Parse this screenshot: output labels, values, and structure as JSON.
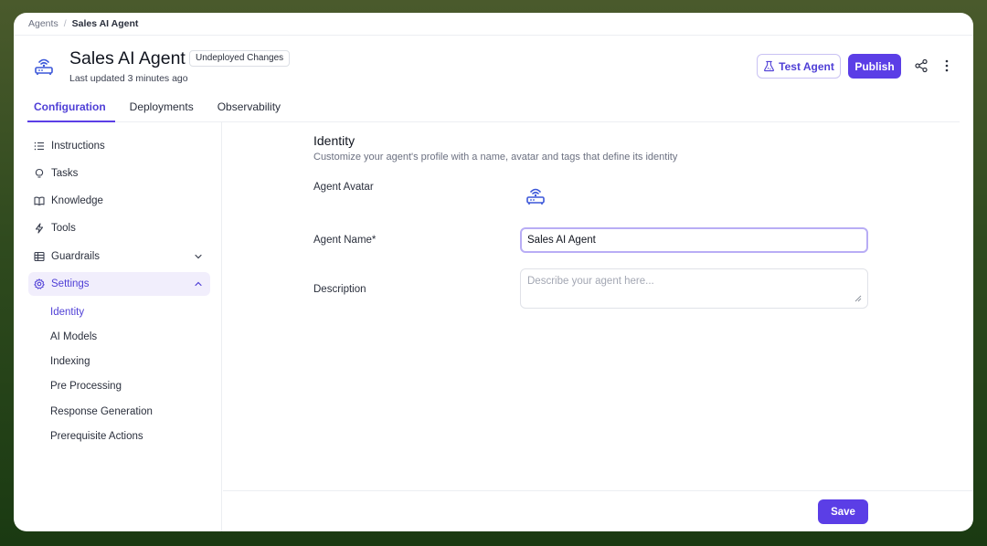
{
  "breadcrumb": {
    "parent": "Agents",
    "separator": "/",
    "current": "Sales AI Agent"
  },
  "header": {
    "title": "Sales AI Agent",
    "badge": "Undeployed Changes",
    "subtitle": "Last updated 3 minutes ago",
    "test_label": "Test Agent",
    "publish_label": "Publish",
    "icons": [
      "router-icon",
      "flask-icon",
      "share-icon",
      "more-vertical-icon"
    ]
  },
  "tabs": [
    {
      "label": "Configuration",
      "active": true
    },
    {
      "label": "Deployments",
      "active": false
    },
    {
      "label": "Observability",
      "active": false
    }
  ],
  "sidebar": {
    "items": [
      {
        "label": "Instructions",
        "icon": "list-icon"
      },
      {
        "label": "Tasks",
        "icon": "lightbulb-icon"
      },
      {
        "label": "Knowledge",
        "icon": "book-icon"
      },
      {
        "label": "Tools",
        "icon": "bolt-icon"
      },
      {
        "label": "Guardrails",
        "icon": "table-icon"
      },
      {
        "label": "Settings",
        "icon": "gear-icon"
      }
    ],
    "sub_items": [
      "Identity",
      "AI Models",
      "Indexing",
      "Pre Processing",
      "Response Generation",
      "Prerequisite Actions"
    ]
  },
  "identity": {
    "title": "Identity",
    "description": "Customize your agent's profile with a name, avatar and tags that define its identity",
    "avatar_label": "Agent Avatar",
    "name_label": "Agent Name*",
    "name_value": "Sales AI Agent",
    "description_label": "Description",
    "description_placeholder": "Describe your agent here..."
  },
  "footer": {
    "save_label": "Save"
  },
  "colors": {
    "accent": "#5b3ee6",
    "accent_light": "#f1eefc",
    "text": "#2a2f3c",
    "muted": "#6b7080"
  }
}
